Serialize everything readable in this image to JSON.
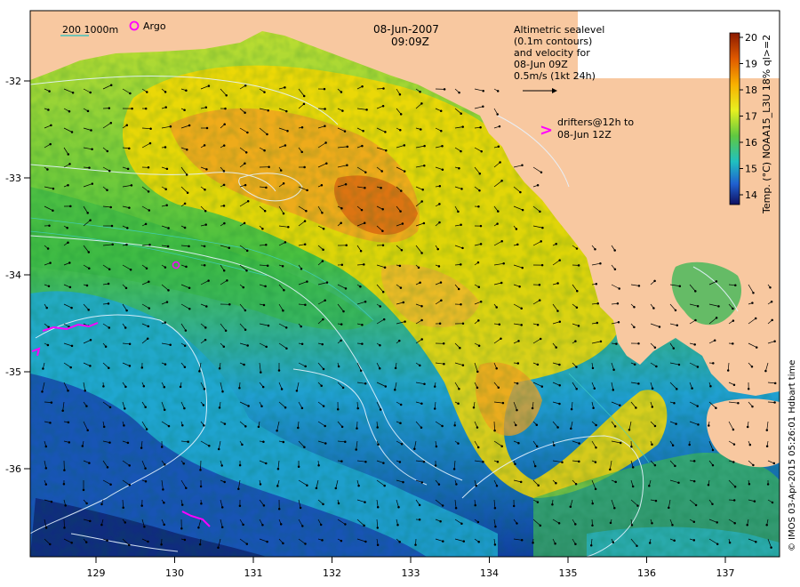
{
  "title": {
    "date": "08-Jun-2007",
    "time": "09:09Z"
  },
  "legend": {
    "scale_label": "200 1000m",
    "argo_label": "Argo"
  },
  "note": {
    "lines": [
      "Altimetric sealevel",
      "(0.1m contours)",
      "and velocity for",
      "08-Jun 09Z",
      "0.5m/s (1kt 24h)"
    ],
    "drifters_line1": "drifters@12h to",
    "drifters_line2": "08-Jun 12Z",
    "drifter_symbol": ">"
  },
  "axes": {
    "x_ticks": [
      "129",
      "130",
      "131",
      "132",
      "133",
      "134",
      "135",
      "136",
      "137"
    ],
    "y_ticks": [
      "-32",
      "-33",
      "-34",
      "-35",
      "-36"
    ]
  },
  "colorbar": {
    "label": "Temp. (°C) NOAA15_L3U 18% ql>=2",
    "ticks": [
      "20",
      "19",
      "18",
      "17",
      "16",
      "15",
      "14"
    ],
    "min": 13.5,
    "max": 20
  },
  "credit": "© IMOS 03-Apr-2015 05:26:01 Hdbart time",
  "colors": {
    "land": "#f8c8a0",
    "warm": "#f0a020",
    "mid": "#c8e030",
    "cool": "#20b0c8",
    "cold": "#103080",
    "drifter": "#ff00ff",
    "contour": "#e6f3ff"
  }
}
